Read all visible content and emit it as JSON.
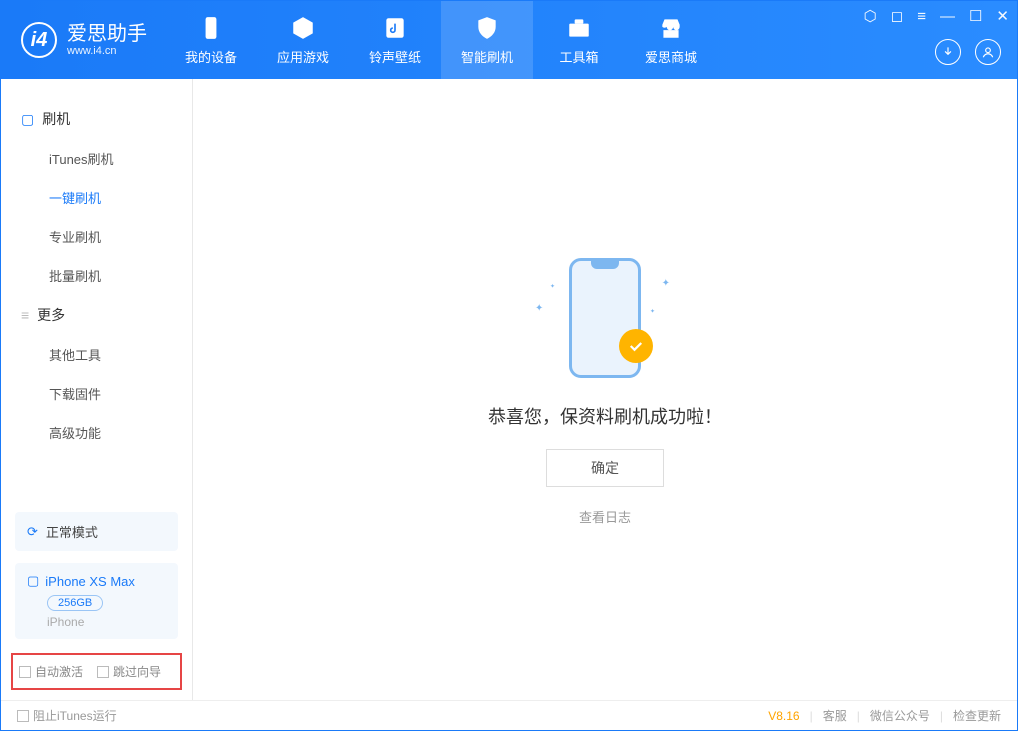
{
  "app": {
    "name": "爱思助手",
    "url": "www.i4.cn"
  },
  "nav": {
    "items": [
      {
        "label": "我的设备"
      },
      {
        "label": "应用游戏"
      },
      {
        "label": "铃声壁纸"
      },
      {
        "label": "智能刷机"
      },
      {
        "label": "工具箱"
      },
      {
        "label": "爱思商城"
      }
    ]
  },
  "sidebar": {
    "section1_title": "刷机",
    "section1_items": [
      {
        "label": "iTunes刷机"
      },
      {
        "label": "一键刷机"
      },
      {
        "label": "专业刷机"
      },
      {
        "label": "批量刷机"
      }
    ],
    "section2_title": "更多",
    "section2_items": [
      {
        "label": "其他工具"
      },
      {
        "label": "下载固件"
      },
      {
        "label": "高级功能"
      }
    ],
    "mode": "正常模式",
    "device": {
      "name": "iPhone XS Max",
      "capacity": "256GB",
      "type": "iPhone"
    },
    "check_auto_activate": "自动激活",
    "check_skip_guide": "跳过向导"
  },
  "main": {
    "success_message": "恭喜您，保资料刷机成功啦！",
    "ok_button": "确定",
    "view_log": "查看日志"
  },
  "footer": {
    "block_itunes": "阻止iTunes运行",
    "version": "V8.16",
    "customer_service": "客服",
    "wechat": "微信公众号",
    "check_update": "检查更新"
  }
}
